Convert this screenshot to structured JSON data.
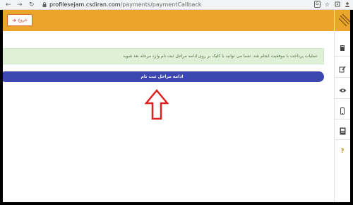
{
  "browser": {
    "url_host": "profilesejam.csdiran.com",
    "url_path": "/payments/paymentCallback",
    "back_glyph": "←",
    "forward_glyph": "→",
    "reload_glyph": "↻"
  },
  "header": {
    "logout_label": "خروج"
  },
  "main": {
    "alert_text": "عملیات پرداخت با موفقیت انجام شد. شما می توانید با کلیک بر روی ادامه مراحل ثبت نام وارد مرحله بعد شوید",
    "continue_button_label": "ادامه مراحل ثبت نام"
  },
  "icons": {
    "browser": [
      "lock-icon",
      "translate-icon",
      "star-icon",
      "extension-icon",
      "profile-icon"
    ],
    "sidebar": [
      "logo-icon",
      "book-icon",
      "edit-icon",
      "eye-icon",
      "mobile-icon",
      "id-card-icon",
      "question-icon"
    ],
    "annotation": "red-up-arrow-icon"
  },
  "colors": {
    "header_orange": "#eba52a",
    "button_blue": "#3c47b0",
    "alert_green_bg": "#dff0d8",
    "alert_text": "#4d6b3c",
    "arrow_red": "#e02020"
  }
}
